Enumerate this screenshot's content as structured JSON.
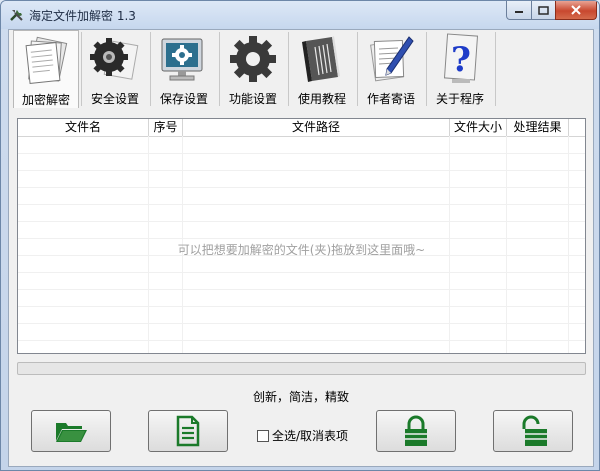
{
  "window": {
    "title": "海定文件加解密 1.3"
  },
  "toolbar": {
    "tabs": [
      {
        "label": "加密解密",
        "icon": "papers-icon",
        "active": true
      },
      {
        "label": "安全设置",
        "icon": "gear-icon",
        "active": false
      },
      {
        "label": "保存设置",
        "icon": "monitor-settings-icon",
        "active": false
      },
      {
        "label": "功能设置",
        "icon": "large-gear-icon",
        "active": false
      },
      {
        "label": "使用教程",
        "icon": "book-icon",
        "active": false
      },
      {
        "label": "作者寄语",
        "icon": "pen-paper-icon",
        "active": false
      },
      {
        "label": "关于程序",
        "icon": "help-question-icon",
        "active": false
      }
    ]
  },
  "file_list": {
    "columns": [
      "文件名",
      "序号",
      "文件路径",
      "文件大小",
      "处理结果"
    ],
    "rows": [],
    "empty_hint": "可以把想要加解密的文件(夹)拖放到这里面哦~"
  },
  "footer": {
    "slogan": "创新，简洁，精致",
    "select_all_label": "全选/取消表项",
    "buttons": {
      "open_folder": "folder-open-icon",
      "open_file": "document-icon",
      "encrypt": "lock-closed-icon",
      "decrypt": "lock-open-icon"
    }
  },
  "colors": {
    "accent_green": "#1b7a2a",
    "question_blue": "#1e3cc8"
  }
}
